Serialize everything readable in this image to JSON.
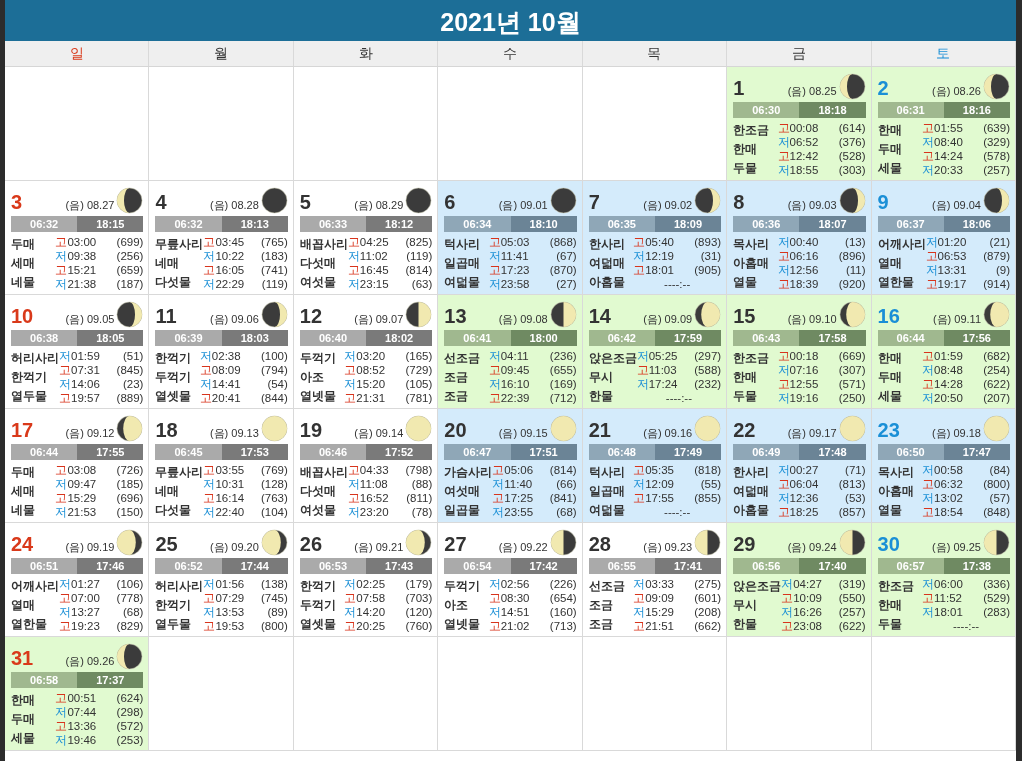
{
  "title": "2021년 10월",
  "weekdays": [
    {
      "label": "일",
      "kind": "sunday"
    },
    {
      "label": "월",
      "kind": "weekday"
    },
    {
      "label": "화",
      "kind": "weekday"
    },
    {
      "label": "수",
      "kind": "weekday"
    },
    {
      "label": "목",
      "kind": "weekday"
    },
    {
      "label": "금",
      "kind": "weekday"
    },
    {
      "label": "토",
      "kind": "saturday"
    }
  ],
  "weeks": [
    {
      "days": [
        {
          "kind": "empty"
        },
        {
          "kind": "empty"
        },
        {
          "kind": "empty"
        },
        {
          "kind": "empty"
        },
        {
          "kind": "empty"
        },
        {
          "kind": "day",
          "day": "1",
          "lunar": "(음) 08.25",
          "moon": {
            "kind": "waning-crescent"
          },
          "color": "#e1fad0",
          "sunrise": "06:30",
          "sunset": "18:18",
          "names": [
            "한조금",
            "한매",
            "두물"
          ],
          "tides": [
            {
              "kind": "high",
              "mark": "고",
              "time": "00:08",
              "height": "(614)"
            },
            {
              "kind": "low",
              "mark": "저",
              "time": "06:52",
              "height": "(376)"
            },
            {
              "kind": "high",
              "mark": "고",
              "time": "12:42",
              "height": "(528)"
            },
            {
              "kind": "low",
              "mark": "저",
              "time": "18:55",
              "height": "(303)"
            }
          ]
        },
        {
          "kind": "day",
          "day": "2",
          "lunar": "(음) 08.26",
          "moon": {
            "kind": "waning-crescent"
          },
          "color": "#e1fad0",
          "sunrise": "06:31",
          "sunset": "18:16",
          "names": [
            "한매",
            "두매",
            "세물"
          ],
          "tides": [
            {
              "kind": "high",
              "mark": "고",
              "time": "01:55",
              "height": "(639)"
            },
            {
              "kind": "low",
              "mark": "저",
              "time": "08:40",
              "height": "(329)"
            },
            {
              "kind": "high",
              "mark": "고",
              "time": "14:24",
              "height": "(578)"
            },
            {
              "kind": "low",
              "mark": "저",
              "time": "20:33",
              "height": "(257)"
            }
          ]
        }
      ]
    },
    {
      "days": [
        {
          "kind": "day",
          "day": "3",
          "lunar": "(음) 08.27",
          "moon": {
            "kind": "waning-crescent"
          },
          "color": "#ffffff",
          "sunrise": "06:32",
          "sunset": "18:15",
          "names": [
            "두매",
            "세매",
            "네물"
          ],
          "tides": [
            {
              "kind": "high",
              "mark": "고",
              "time": "03:00",
              "height": "(699)"
            },
            {
              "kind": "low",
              "mark": "저",
              "time": "09:38",
              "height": "(256)"
            },
            {
              "kind": "high",
              "mark": "고",
              "time": "15:21",
              "height": "(659)"
            },
            {
              "kind": "low",
              "mark": "저",
              "time": "21:38",
              "height": "(187)"
            }
          ]
        },
        {
          "kind": "day",
          "day": "4",
          "lunar": "(음) 08.28",
          "moon": {
            "kind": "new"
          },
          "color": "#ffffff",
          "sunrise": "06:32",
          "sunset": "18:13",
          "names": [
            "무릎사리",
            "네매",
            "다섯물"
          ],
          "tides": [
            {
              "kind": "high",
              "mark": "고",
              "time": "03:45",
              "height": "(765)"
            },
            {
              "kind": "low",
              "mark": "저",
              "time": "10:22",
              "height": "(183)"
            },
            {
              "kind": "high",
              "mark": "고",
              "time": "16:05",
              "height": "(741)"
            },
            {
              "kind": "low",
              "mark": "저",
              "time": "22:29",
              "height": "(119)"
            }
          ]
        },
        {
          "kind": "day",
          "day": "5",
          "lunar": "(음) 08.29",
          "moon": {
            "kind": "new"
          },
          "color": "#ffffff",
          "sunrise": "06:33",
          "sunset": "18:12",
          "names": [
            "배꼽사리",
            "다섯매",
            "여섯물"
          ],
          "tides": [
            {
              "kind": "high",
              "mark": "고",
              "time": "04:25",
              "height": "(825)"
            },
            {
              "kind": "low",
              "mark": "저",
              "time": "11:02",
              "height": "(119)"
            },
            {
              "kind": "high",
              "mark": "고",
              "time": "16:45",
              "height": "(814)"
            },
            {
              "kind": "low",
              "mark": "저",
              "time": "23:15",
              "height": "(63)"
            }
          ]
        },
        {
          "kind": "day",
          "day": "6",
          "lunar": "(음) 09.01",
          "moon": {
            "kind": "new"
          },
          "color": "#d4ebfb",
          "sunrise": "06:34",
          "sunset": "18:10",
          "names": [
            "턱사리",
            "일곱매",
            "여덟물"
          ],
          "tides": [
            {
              "kind": "high",
              "mark": "고",
              "time": "05:03",
              "height": "(868)"
            },
            {
              "kind": "low",
              "mark": "저",
              "time": "11:41",
              "height": "(67)"
            },
            {
              "kind": "high",
              "mark": "고",
              "time": "17:23",
              "height": "(870)"
            },
            {
              "kind": "low",
              "mark": "저",
              "time": "23:58",
              "height": "(27)"
            }
          ]
        },
        {
          "kind": "day",
          "day": "7",
          "lunar": "(음) 09.02",
          "moon": {
            "kind": "waxing-crescent"
          },
          "color": "#d4ebfb",
          "sunrise": "06:35",
          "sunset": "18:09",
          "names": [
            "한사리",
            "여덟매",
            "아홉물"
          ],
          "tides": [
            {
              "kind": "high",
              "mark": "고",
              "time": "05:40",
              "height": "(893)"
            },
            {
              "kind": "low",
              "mark": "저",
              "time": "12:19",
              "height": "(31)"
            },
            {
              "kind": "high",
              "mark": "고",
              "time": "18:01",
              "height": "(905)"
            },
            {
              "kind": "none",
              "time": "----:--"
            }
          ]
        },
        {
          "kind": "day",
          "day": "8",
          "lunar": "(음) 09.03",
          "moon": {
            "kind": "waxing-crescent"
          },
          "color": "#d4ebfb",
          "sunrise": "06:36",
          "sunset": "18:07",
          "names": [
            "목사리",
            "아홉매",
            "열물"
          ],
          "tides": [
            {
              "kind": "low",
              "mark": "저",
              "time": "00:40",
              "height": "(13)"
            },
            {
              "kind": "high",
              "mark": "고",
              "time": "06:16",
              "height": "(896)"
            },
            {
              "kind": "low",
              "mark": "저",
              "time": "12:56",
              "height": "(11)"
            },
            {
              "kind": "high",
              "mark": "고",
              "time": "18:39",
              "height": "(920)"
            }
          ]
        },
        {
          "kind": "day",
          "day": "9",
          "lunar": "(음) 09.04",
          "moon": {
            "kind": "waxing-crescent"
          },
          "color": "#d4ebfb",
          "sunrise": "06:37",
          "sunset": "18:06",
          "names": [
            "어깨사리",
            "열매",
            "열한물"
          ],
          "tides": [
            {
              "kind": "low",
              "mark": "저",
              "time": "01:20",
              "height": "(21)"
            },
            {
              "kind": "high",
              "mark": "고",
              "time": "06:53",
              "height": "(879)"
            },
            {
              "kind": "low",
              "mark": "저",
              "time": "13:31",
              "height": "(9)"
            },
            {
              "kind": "high",
              "mark": "고",
              "time": "19:17",
              "height": "(914)"
            }
          ]
        }
      ]
    },
    {
      "days": [
        {
          "kind": "day",
          "day": "10",
          "lunar": "(음) 09.05",
          "moon": {
            "kind": "waxing-crescent"
          },
          "color": "#ffffff",
          "sunrise": "06:38",
          "sunset": "18:05",
          "names": [
            "허리사리",
            "한꺽기",
            "열두물"
          ],
          "tides": [
            {
              "kind": "low",
              "mark": "저",
              "time": "01:59",
              "height": "(51)"
            },
            {
              "kind": "high",
              "mark": "고",
              "time": "07:31",
              "height": "(845)"
            },
            {
              "kind": "low",
              "mark": "저",
              "time": "14:06",
              "height": "(23)"
            },
            {
              "kind": "high",
              "mark": "고",
              "time": "19:57",
              "height": "(889)"
            }
          ]
        },
        {
          "kind": "day",
          "day": "11",
          "lunar": "(음) 09.06",
          "moon": {
            "kind": "waxing-crescent"
          },
          "color": "#ffffff",
          "sunrise": "06:39",
          "sunset": "18:03",
          "names": [
            "한꺽기",
            "두꺽기",
            "열셋물"
          ],
          "tides": [
            {
              "kind": "low",
              "mark": "저",
              "time": "02:38",
              "height": "(100)"
            },
            {
              "kind": "high",
              "mark": "고",
              "time": "08:09",
              "height": "(794)"
            },
            {
              "kind": "low",
              "mark": "저",
              "time": "14:41",
              "height": "(54)"
            },
            {
              "kind": "high",
              "mark": "고",
              "time": "20:41",
              "height": "(844)"
            }
          ]
        },
        {
          "kind": "day",
          "day": "12",
          "lunar": "(음) 09.07",
          "moon": {
            "kind": "waxing-half"
          },
          "color": "#ffffff",
          "sunrise": "06:40",
          "sunset": "18:02",
          "names": [
            "두꺽기",
            "아조",
            "열넷물"
          ],
          "tides": [
            {
              "kind": "low",
              "mark": "저",
              "time": "03:20",
              "height": "(165)"
            },
            {
              "kind": "high",
              "mark": "고",
              "time": "08:52",
              "height": "(729)"
            },
            {
              "kind": "low",
              "mark": "저",
              "time": "15:20",
              "height": "(105)"
            },
            {
              "kind": "high",
              "mark": "고",
              "time": "21:31",
              "height": "(781)"
            }
          ]
        },
        {
          "kind": "day",
          "day": "13",
          "lunar": "(음) 09.08",
          "moon": {
            "kind": "waxing-half"
          },
          "color": "#e1fad0",
          "sunrise": "06:41",
          "sunset": "18:00",
          "names": [
            "선조금",
            "조금",
            "조금"
          ],
          "tides": [
            {
              "kind": "low",
              "mark": "저",
              "time": "04:11",
              "height": "(236)"
            },
            {
              "kind": "high",
              "mark": "고",
              "time": "09:45",
              "height": "(655)"
            },
            {
              "kind": "low",
              "mark": "저",
              "time": "16:10",
              "height": "(169)"
            },
            {
              "kind": "high",
              "mark": "고",
              "time": "22:39",
              "height": "(712)"
            }
          ]
        },
        {
          "kind": "day",
          "day": "14",
          "lunar": "(음) 09.09",
          "moon": {
            "kind": "waxing-gibbous"
          },
          "color": "#e1fad0",
          "sunrise": "06:42",
          "sunset": "17:59",
          "names": [
            "앉은조금",
            "무시",
            "한물"
          ],
          "tides": [
            {
              "kind": "low",
              "mark": "저",
              "time": "05:25",
              "height": "(297)"
            },
            {
              "kind": "high",
              "mark": "고",
              "time": "11:03",
              "height": "(588)"
            },
            {
              "kind": "low",
              "mark": "저",
              "time": "17:24",
              "height": "(232)"
            },
            {
              "kind": "none",
              "time": "----:--"
            }
          ]
        },
        {
          "kind": "day",
          "day": "15",
          "lunar": "(음) 09.10",
          "moon": {
            "kind": "waxing-gibbous"
          },
          "color": "#e1fad0",
          "sunrise": "06:43",
          "sunset": "17:58",
          "names": [
            "한조금",
            "한매",
            "두물"
          ],
          "tides": [
            {
              "kind": "high",
              "mark": "고",
              "time": "00:18",
              "height": "(669)"
            },
            {
              "kind": "low",
              "mark": "저",
              "time": "07:16",
              "height": "(307)"
            },
            {
              "kind": "high",
              "mark": "고",
              "time": "12:55",
              "height": "(571)"
            },
            {
              "kind": "low",
              "mark": "저",
              "time": "19:16",
              "height": "(250)"
            }
          ]
        },
        {
          "kind": "day",
          "day": "16",
          "lunar": "(음) 09.11",
          "moon": {
            "kind": "waxing-gibbous"
          },
          "color": "#e1fad0",
          "sunrise": "06:44",
          "sunset": "17:56",
          "names": [
            "한매",
            "두매",
            "세물"
          ],
          "tides": [
            {
              "kind": "high",
              "mark": "고",
              "time": "01:59",
              "height": "(682)"
            },
            {
              "kind": "low",
              "mark": "저",
              "time": "08:48",
              "height": "(254)"
            },
            {
              "kind": "high",
              "mark": "고",
              "time": "14:28",
              "height": "(622)"
            },
            {
              "kind": "low",
              "mark": "저",
              "time": "20:50",
              "height": "(207)"
            }
          ]
        }
      ]
    },
    {
      "days": [
        {
          "kind": "day",
          "day": "17",
          "lunar": "(음) 09.12",
          "moon": {
            "kind": "waxing-gibbous"
          },
          "color": "#ffffff",
          "sunrise": "06:44",
          "sunset": "17:55",
          "names": [
            "두매",
            "세매",
            "네물"
          ],
          "tides": [
            {
              "kind": "high",
              "mark": "고",
              "time": "03:08",
              "height": "(726)"
            },
            {
              "kind": "low",
              "mark": "저",
              "time": "09:47",
              "height": "(185)"
            },
            {
              "kind": "high",
              "mark": "고",
              "time": "15:29",
              "height": "(696)"
            },
            {
              "kind": "low",
              "mark": "저",
              "time": "21:53",
              "height": "(150)"
            }
          ]
        },
        {
          "kind": "day",
          "day": "18",
          "lunar": "(음) 09.13",
          "moon": {
            "kind": "full"
          },
          "color": "#ffffff",
          "sunrise": "06:45",
          "sunset": "17:53",
          "names": [
            "무릎사리",
            "네매",
            "다섯물"
          ],
          "tides": [
            {
              "kind": "high",
              "mark": "고",
              "time": "03:55",
              "height": "(769)"
            },
            {
              "kind": "low",
              "mark": "저",
              "time": "10:31",
              "height": "(128)"
            },
            {
              "kind": "high",
              "mark": "고",
              "time": "16:14",
              "height": "(763)"
            },
            {
              "kind": "low",
              "mark": "저",
              "time": "22:40",
              "height": "(104)"
            }
          ]
        },
        {
          "kind": "day",
          "day": "19",
          "lunar": "(음) 09.14",
          "moon": {
            "kind": "full"
          },
          "color": "#ffffff",
          "sunrise": "06:46",
          "sunset": "17:52",
          "names": [
            "배꼽사리",
            "다섯매",
            "여섯물"
          ],
          "tides": [
            {
              "kind": "high",
              "mark": "고",
              "time": "04:33",
              "height": "(798)"
            },
            {
              "kind": "low",
              "mark": "저",
              "time": "11:08",
              "height": "(88)"
            },
            {
              "kind": "high",
              "mark": "고",
              "time": "16:52",
              "height": "(811)"
            },
            {
              "kind": "low",
              "mark": "저",
              "time": "23:20",
              "height": "(78)"
            }
          ]
        },
        {
          "kind": "day",
          "day": "20",
          "lunar": "(음) 09.15",
          "moon": {
            "kind": "full"
          },
          "color": "#d4ebfb",
          "sunrise": "06:47",
          "sunset": "17:51",
          "names": [
            "가슴사리",
            "여섯매",
            "일곱물"
          ],
          "tides": [
            {
              "kind": "high",
              "mark": "고",
              "time": "05:06",
              "height": "(814)"
            },
            {
              "kind": "low",
              "mark": "저",
              "time": "11:40",
              "height": "(66)"
            },
            {
              "kind": "high",
              "mark": "고",
              "time": "17:25",
              "height": "(841)"
            },
            {
              "kind": "low",
              "mark": "저",
              "time": "23:55",
              "height": "(68)"
            }
          ]
        },
        {
          "kind": "day",
          "day": "21",
          "lunar": "(음) 09.16",
          "moon": {
            "kind": "full"
          },
          "color": "#d4ebfb",
          "sunrise": "06:48",
          "sunset": "17:49",
          "names": [
            "턱사리",
            "일곱매",
            "여덟물"
          ],
          "tides": [
            {
              "kind": "high",
              "mark": "고",
              "time": "05:35",
              "height": "(818)"
            },
            {
              "kind": "low",
              "mark": "저",
              "time": "12:09",
              "height": "(55)"
            },
            {
              "kind": "high",
              "mark": "고",
              "time": "17:55",
              "height": "(855)"
            },
            {
              "kind": "none",
              "time": "----:--"
            }
          ]
        },
        {
          "kind": "day",
          "day": "22",
          "lunar": "(음) 09.17",
          "moon": {
            "kind": "full"
          },
          "color": "#d4ebfb",
          "sunrise": "06:49",
          "sunset": "17:48",
          "names": [
            "한사리",
            "여덟매",
            "아홉물"
          ],
          "tides": [
            {
              "kind": "low",
              "mark": "저",
              "time": "00:27",
              "height": "(71)"
            },
            {
              "kind": "high",
              "mark": "고",
              "time": "06:04",
              "height": "(813)"
            },
            {
              "kind": "low",
              "mark": "저",
              "time": "12:36",
              "height": "(53)"
            },
            {
              "kind": "high",
              "mark": "고",
              "time": "18:25",
              "height": "(857)"
            }
          ]
        },
        {
          "kind": "day",
          "day": "23",
          "lunar": "(음) 09.18",
          "moon": {
            "kind": "full"
          },
          "color": "#d4ebfb",
          "sunrise": "06:50",
          "sunset": "17:47",
          "names": [
            "목사리",
            "아홉매",
            "열물"
          ],
          "tides": [
            {
              "kind": "low",
              "mark": "저",
              "time": "00:58",
              "height": "(84)"
            },
            {
              "kind": "high",
              "mark": "고",
              "time": "06:32",
              "height": "(800)"
            },
            {
              "kind": "low",
              "mark": "저",
              "time": "13:02",
              "height": "(57)"
            },
            {
              "kind": "high",
              "mark": "고",
              "time": "18:54",
              "height": "(848)"
            }
          ]
        }
      ]
    },
    {
      "days": [
        {
          "kind": "day",
          "day": "24",
          "lunar": "(음) 09.19",
          "moon": {
            "kind": "waning-gibbous"
          },
          "color": "#ffffff",
          "sunrise": "06:51",
          "sunset": "17:46",
          "names": [
            "어깨사리",
            "열매",
            "열한물"
          ],
          "tides": [
            {
              "kind": "low",
              "mark": "저",
              "time": "01:27",
              "height": "(106)"
            },
            {
              "kind": "high",
              "mark": "고",
              "time": "07:00",
              "height": "(778)"
            },
            {
              "kind": "low",
              "mark": "저",
              "time": "13:27",
              "height": "(68)"
            },
            {
              "kind": "high",
              "mark": "고",
              "time": "19:23",
              "height": "(829)"
            }
          ]
        },
        {
          "kind": "day",
          "day": "25",
          "lunar": "(음) 09.20",
          "moon": {
            "kind": "waning-gibbous"
          },
          "color": "#ffffff",
          "sunrise": "06:52",
          "sunset": "17:44",
          "names": [
            "허리사리",
            "한꺽기",
            "열두물"
          ],
          "tides": [
            {
              "kind": "low",
              "mark": "저",
              "time": "01:56",
              "height": "(138)"
            },
            {
              "kind": "high",
              "mark": "고",
              "time": "07:29",
              "height": "(745)"
            },
            {
              "kind": "low",
              "mark": "저",
              "time": "13:53",
              "height": "(89)"
            },
            {
              "kind": "high",
              "mark": "고",
              "time": "19:53",
              "height": "(800)"
            }
          ]
        },
        {
          "kind": "day",
          "day": "26",
          "lunar": "(음) 09.21",
          "moon": {
            "kind": "waning-gibbous"
          },
          "color": "#ffffff",
          "sunrise": "06:53",
          "sunset": "17:43",
          "names": [
            "한꺽기",
            "두꺽기",
            "열셋물"
          ],
          "tides": [
            {
              "kind": "low",
              "mark": "저",
              "time": "02:25",
              "height": "(179)"
            },
            {
              "kind": "high",
              "mark": "고",
              "time": "07:58",
              "height": "(703)"
            },
            {
              "kind": "low",
              "mark": "저",
              "time": "14:20",
              "height": "(120)"
            },
            {
              "kind": "high",
              "mark": "고",
              "time": "20:25",
              "height": "(760)"
            }
          ]
        },
        {
          "kind": "day",
          "day": "27",
          "lunar": "(음) 09.22",
          "moon": {
            "kind": "waning-half"
          },
          "color": "#ffffff",
          "sunrise": "06:54",
          "sunset": "17:42",
          "names": [
            "두꺽기",
            "아조",
            "열넷물"
          ],
          "tides": [
            {
              "kind": "low",
              "mark": "저",
              "time": "02:56",
              "height": "(226)"
            },
            {
              "kind": "high",
              "mark": "고",
              "time": "08:30",
              "height": "(654)"
            },
            {
              "kind": "low",
              "mark": "저",
              "time": "14:51",
              "height": "(160)"
            },
            {
              "kind": "high",
              "mark": "고",
              "time": "21:02",
              "height": "(713)"
            }
          ]
        },
        {
          "kind": "day",
          "day": "28",
          "lunar": "(음) 09.23",
          "moon": {
            "kind": "waning-half"
          },
          "color": "#ffffff",
          "sunrise": "06:55",
          "sunset": "17:41",
          "names": [
            "선조금",
            "조금",
            "조금"
          ],
          "tides": [
            {
              "kind": "low",
              "mark": "저",
              "time": "03:33",
              "height": "(275)"
            },
            {
              "kind": "high",
              "mark": "고",
              "time": "09:09",
              "height": "(601)"
            },
            {
              "kind": "low",
              "mark": "저",
              "time": "15:29",
              "height": "(208)"
            },
            {
              "kind": "high",
              "mark": "고",
              "time": "21:51",
              "height": "(662)"
            }
          ]
        },
        {
          "kind": "day",
          "day": "29",
          "lunar": "(음) 09.24",
          "moon": {
            "kind": "waning-half"
          },
          "color": "#e1fad0",
          "sunrise": "06:56",
          "sunset": "17:40",
          "names": [
            "앉은조금",
            "무시",
            "한물"
          ],
          "tides": [
            {
              "kind": "low",
              "mark": "저",
              "time": "04:27",
              "height": "(319)"
            },
            {
              "kind": "high",
              "mark": "고",
              "time": "10:09",
              "height": "(550)"
            },
            {
              "kind": "low",
              "mark": "저",
              "time": "16:26",
              "height": "(257)"
            },
            {
              "kind": "high",
              "mark": "고",
              "time": "23:08",
              "height": "(622)"
            }
          ]
        },
        {
          "kind": "day",
          "day": "30",
          "lunar": "(음) 09.25",
          "moon": {
            "kind": "waning-half"
          },
          "color": "#e1fad0",
          "sunrise": "06:57",
          "sunset": "17:38",
          "names": [
            "한조금",
            "한매",
            "두물"
          ],
          "tides": [
            {
              "kind": "low",
              "mark": "저",
              "time": "06:00",
              "height": "(336)"
            },
            {
              "kind": "high",
              "mark": "고",
              "time": "11:52",
              "height": "(529)"
            },
            {
              "kind": "low",
              "mark": "저",
              "time": "18:01",
              "height": "(283)"
            },
            {
              "kind": "none",
              "time": "----:--"
            }
          ]
        }
      ]
    },
    {
      "days": [
        {
          "kind": "day",
          "day": "31",
          "lunar": "(음) 09.26",
          "moon": {
            "kind": "waning-crescent"
          },
          "color": "#e1fad0",
          "sunrise": "06:58",
          "sunset": "17:37",
          "names": [
            "한매",
            "두매",
            "세물"
          ],
          "tides": [
            {
              "kind": "high",
              "mark": "고",
              "time": "00:51",
              "height": "(624)"
            },
            {
              "kind": "low",
              "mark": "저",
              "time": "07:44",
              "height": "(298)"
            },
            {
              "kind": "high",
              "mark": "고",
              "time": "13:36",
              "height": "(572)"
            },
            {
              "kind": "low",
              "mark": "저",
              "time": "19:46",
              "height": "(253)"
            }
          ]
        },
        {
          "kind": "empty"
        },
        {
          "kind": "empty"
        },
        {
          "kind": "empty"
        },
        {
          "kind": "empty"
        },
        {
          "kind": "empty"
        },
        {
          "kind": "empty"
        }
      ]
    }
  ]
}
